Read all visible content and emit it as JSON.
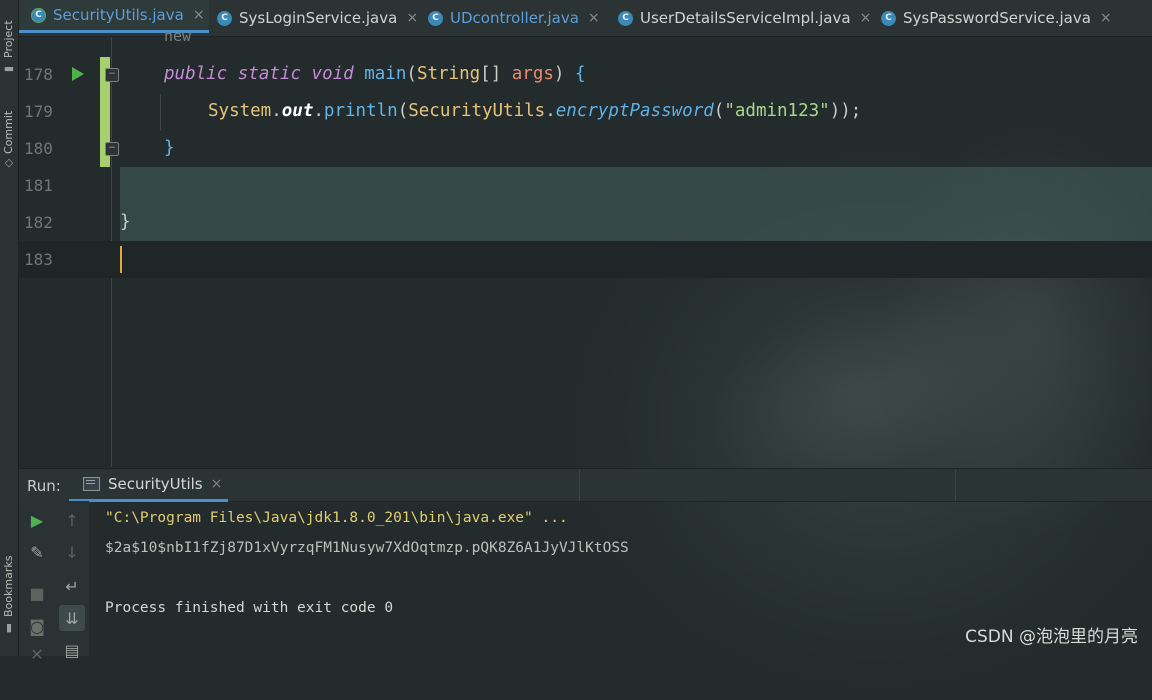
{
  "left_strip": {
    "project_label": "Project",
    "commit_label": "Commit",
    "bookmarks_label": "Bookmarks",
    "icons": [
      "folder-icon",
      "commit-icon",
      "bookmark-icon"
    ]
  },
  "tabs": [
    {
      "label": "SecurityUtils.java",
      "active": true,
      "icon": "class-icon"
    },
    {
      "label": "SysLoginService.java",
      "active": false,
      "icon": "class-icon"
    },
    {
      "label": "UDcontroller.java",
      "active": false,
      "icon": "class-icon"
    },
    {
      "label": "UserDetailsServiceImpl.java",
      "active": false,
      "icon": "class-icon"
    },
    {
      "label": "SysPasswordService.java",
      "active": false,
      "icon": "class-icon"
    }
  ],
  "tab_close_glyph": "×",
  "editor": {
    "inlay_hint": "new",
    "lines": [
      {
        "number": "178"
      },
      {
        "number": "179"
      },
      {
        "number": "180"
      },
      {
        "number": "181"
      },
      {
        "number": "182"
      },
      {
        "number": "183"
      }
    ],
    "code": {
      "l178": {
        "kw1": "public",
        "kw2": "static",
        "kw3": "void",
        "name": "main",
        "open_paren": "(",
        "type": "String",
        "brackets": "[] ",
        "param": "args",
        "close": ") ",
        "brace": "{"
      },
      "l179": {
        "cls": "System",
        "dot1": ".",
        "field": "out",
        "dot2": ".",
        "call": "println",
        "p1": "(",
        "cls2": "SecurityUtils",
        "dot3": ".",
        "meth": "encryptPassword",
        "p2": "(",
        "str": "\"admin123\"",
        "end": "));"
      },
      "l180": {
        "brace": "}"
      },
      "l182": {
        "brace": "}"
      }
    }
  },
  "run_panel": {
    "label": "Run:",
    "tab_label": "SecurityUtils",
    "console": [
      "\"C:\\Program Files\\Java\\jdk1.8.0_201\\bin\\java.exe\" ...",
      "$2a$10$nbI1fZj87D1xVyrzqFM1Nusyw7XdOqtmzp.pQK8Z6A1JyVJlKtOSS",
      "",
      "Process finished with exit code 0"
    ],
    "tools": [
      "run-icon",
      "up-arrow-icon",
      "wrench-icon",
      "down-arrow-icon",
      "stop-icon",
      "soft-wrap-icon",
      "camera-icon",
      "scroll-to-end-icon",
      "close-icon",
      "print-icon"
    ]
  },
  "watermark": "CSDN @泡泡里的月亮",
  "colors": {
    "background": "#232b2c",
    "accent_tab": "#4a8fc7",
    "change_bar": "#a7cf6d",
    "run_green": "#4fb24f",
    "keyword": "#c58bd6",
    "string": "#a6d98c",
    "type": "#e6c47a"
  }
}
